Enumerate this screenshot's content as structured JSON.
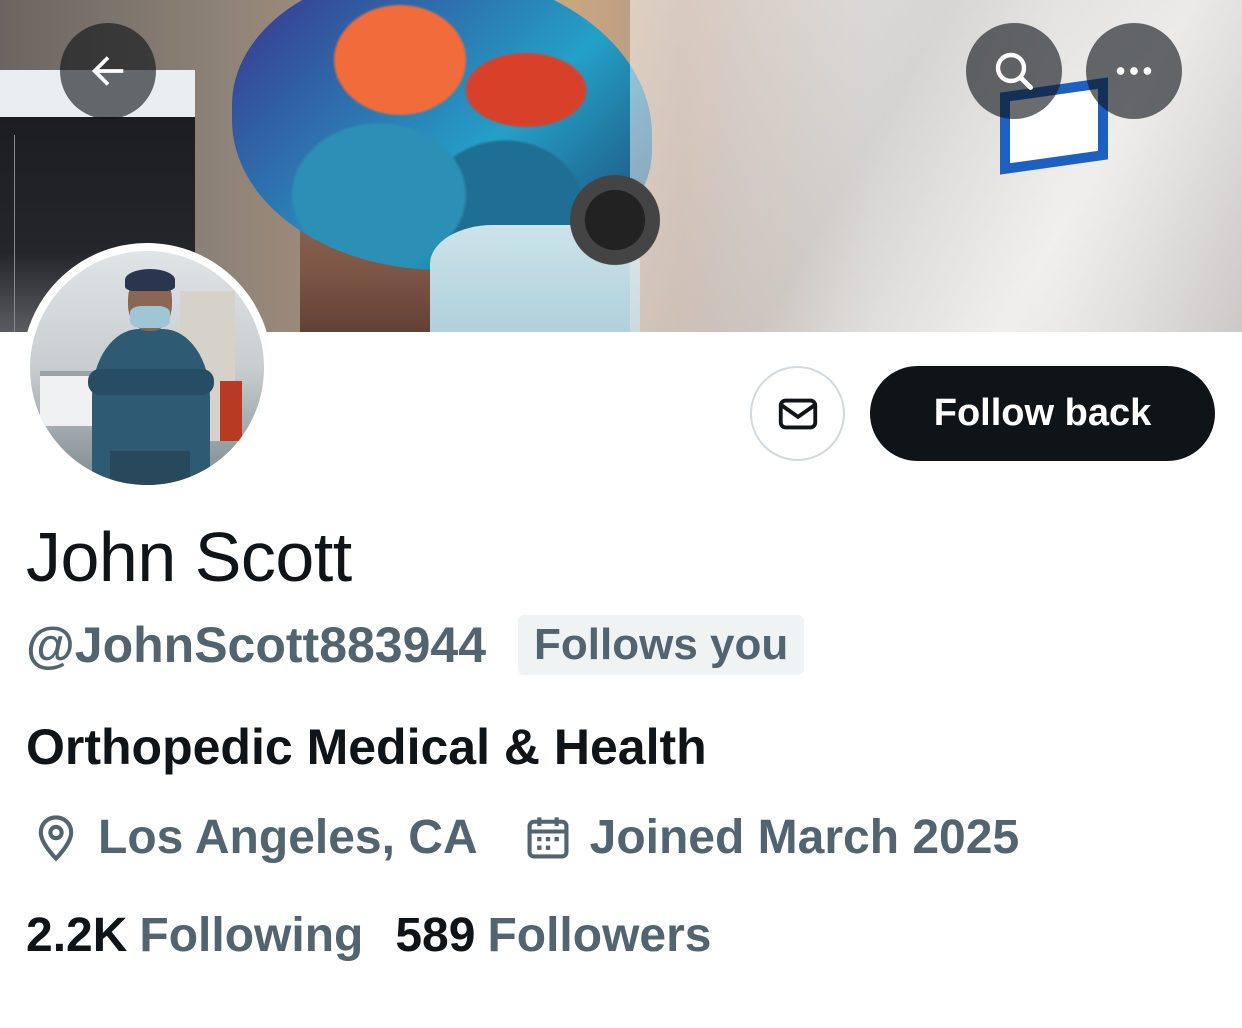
{
  "header": {
    "back_icon": "arrow-left-icon",
    "search_icon": "search-icon",
    "more_icon": "more-horizontal-icon"
  },
  "actions": {
    "message_icon": "envelope-icon",
    "follow_back_label": "Follow back"
  },
  "profile": {
    "name": "John Scott",
    "handle": "@JohnScott883944",
    "follows_you_badge": "Follows you",
    "bio": "Orthopedic Medical & Health",
    "location": "Los Angeles, CA",
    "joined": "Joined March 2025",
    "following_count": "2.2K",
    "following_label": "Following",
    "followers_count": "589",
    "followers_label": "Followers"
  },
  "colors": {
    "primary_text": "#0f1419",
    "secondary_text": "#536471",
    "button_dark": "#0f1419",
    "badge_bg": "#eff3f4",
    "border": "#cfd9de"
  }
}
